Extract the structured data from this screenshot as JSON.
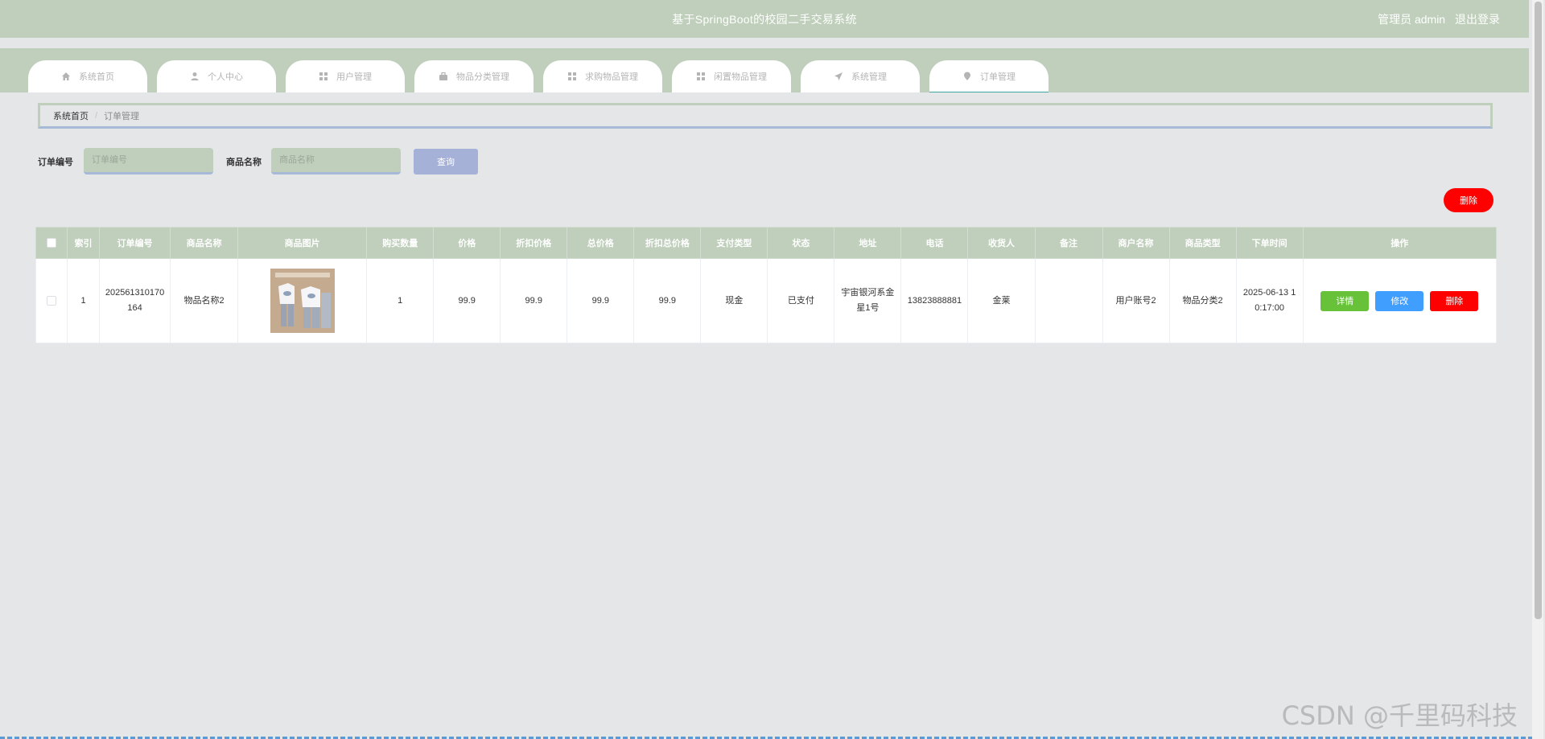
{
  "header": {
    "title": "基于SpringBoot的校园二手交易系统",
    "role": "管理员 admin",
    "logout": "退出登录"
  },
  "nav": [
    {
      "label": "系统首页",
      "icon": "home-icon"
    },
    {
      "label": "个人中心",
      "icon": "user-icon"
    },
    {
      "label": "用户管理",
      "icon": "grid-icon"
    },
    {
      "label": "物品分类管理",
      "icon": "briefcase-icon"
    },
    {
      "label": "求购物品管理",
      "icon": "grid-icon"
    },
    {
      "label": "闲置物品管理",
      "icon": "grid-icon"
    },
    {
      "label": "系统管理",
      "icon": "send-icon"
    },
    {
      "label": "订单管理",
      "icon": "pin-icon",
      "active": true
    }
  ],
  "breadcrumb": {
    "home": "系统首页",
    "separator": "/",
    "current": "订单管理"
  },
  "search": {
    "order_no_label": "订单编号",
    "order_no_placeholder": "订单编号",
    "order_no_value": "",
    "product_label": "商品名称",
    "product_placeholder": "商品名称",
    "product_value": "",
    "query_button": "查询"
  },
  "delete_button": "删除",
  "table": {
    "columns": [
      "索引",
      "订单编号",
      "商品名称",
      "商品图片",
      "购买数量",
      "价格",
      "折扣价格",
      "总价格",
      "折扣总价格",
      "支付类型",
      "状态",
      "地址",
      "电话",
      "收货人",
      "备注",
      "商户名称",
      "商品类型",
      "下单时间",
      "操作"
    ],
    "rows": [
      {
        "index": "1",
        "order_no": "202561310170164",
        "product_name": "物品名称2",
        "quantity": "1",
        "price": "99.9",
        "discount_price": "99.9",
        "total_price": "99.9",
        "discount_total": "99.9",
        "pay_type": "现金",
        "status": "已支付",
        "address": "宇宙银河系金星1号",
        "phone": "13823888881",
        "receiver": "金莱",
        "remark": "",
        "merchant": "用户账号2",
        "product_type": "物品分类2",
        "order_time": "2025-06-13 10:17:00",
        "actions": {
          "detail": "详情",
          "edit": "修改",
          "delete": "删除"
        }
      }
    ]
  },
  "watermark": "CSDN @千里码科技",
  "colors": {
    "theme": "#bfcfbb",
    "danger": "#ff0000",
    "success": "#67c23a",
    "primary": "#409eff",
    "query": "#a6b1d8"
  }
}
